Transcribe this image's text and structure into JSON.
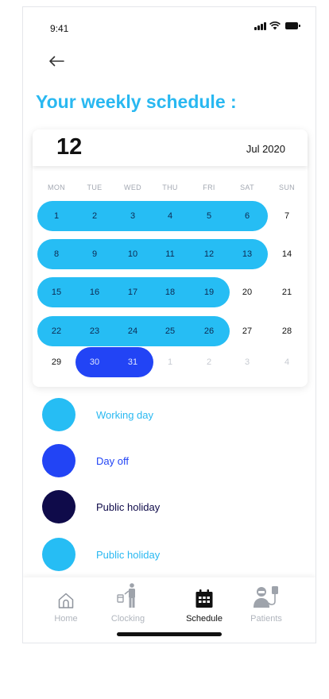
{
  "status_bar": {
    "time": "9:41"
  },
  "page": {
    "title": "Your weekly schedule :"
  },
  "calendar": {
    "day_number": "12",
    "month_label": "Jul 2020",
    "weekdays": [
      "MON",
      "TUE",
      "WED",
      "THU",
      "FRI",
      "SAT",
      "SUN"
    ],
    "weeks": [
      {
        "days": [
          "1",
          "2",
          "3",
          "4",
          "5",
          "6",
          "7"
        ],
        "pill_days": 6,
        "pill_type": "working"
      },
      {
        "days": [
          "8",
          "9",
          "10",
          "11",
          "12",
          "13",
          "14"
        ],
        "pill_days": 6,
        "pill_type": "working"
      },
      {
        "days": [
          "15",
          "16",
          "17",
          "18",
          "19",
          "20",
          "21"
        ],
        "pill_days": 5,
        "pill_type": "working"
      },
      {
        "days": [
          "22",
          "23",
          "24",
          "25",
          "26",
          "27",
          "28"
        ],
        "pill_days": 5,
        "pill_type": "working"
      },
      {
        "days": [
          "29",
          "30",
          "31",
          "1",
          "2",
          "3",
          "4"
        ],
        "pill_start": 1,
        "pill_days": 2,
        "pill_type": "off",
        "faded_from": 3
      }
    ]
  },
  "legend": [
    {
      "label": "Working day",
      "color": "#26bdf4",
      "text_color": "#29b8f1"
    },
    {
      "label": "Day off",
      "color": "#2244f5",
      "text_color": "#2244f5"
    },
    {
      "label": "Public holiday",
      "color": "#0f0b4a",
      "text_color": "#0f0b4a"
    },
    {
      "label": "Public holiday",
      "color": "#26bdf4",
      "text_color": "#29b8f1"
    }
  ],
  "nav": [
    {
      "label": "Home",
      "icon": "home-icon",
      "active": false
    },
    {
      "label": "Clocking",
      "icon": "clocking-icon",
      "active": false
    },
    {
      "label": "Schedule",
      "icon": "calendar-icon",
      "active": true
    },
    {
      "label": "Patients",
      "icon": "patient-icon",
      "active": false
    }
  ],
  "colors": {
    "accent": "#29b8f1",
    "working": "#26bdf4",
    "day_off": "#2244f5",
    "holiday": "#0f0b4a"
  }
}
